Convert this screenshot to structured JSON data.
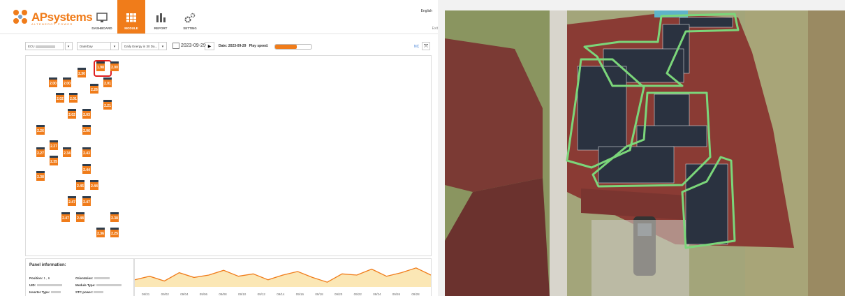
{
  "brand": {
    "name": "APsystems",
    "tagline": "ALTENERGY POWER"
  },
  "nav": [
    {
      "label": "DASHBOARD",
      "icon": "monitor-icon",
      "active": false
    },
    {
      "label": "MODULE",
      "icon": "grid-icon",
      "active": true
    },
    {
      "label": "REPORT",
      "icon": "bar-chart-icon",
      "active": false
    },
    {
      "label": "SETTING",
      "icon": "gear-icon",
      "active": false
    }
  ],
  "header": {
    "language": "English",
    "logout": "Exit"
  },
  "toolbar": {
    "ecu_select": "ECU ",
    "mode_select": "Date/Day",
    "energy_select": "Daily Energy in 30 Da...",
    "date": "2023-09-29",
    "date_label": "Date: 2023-09-29",
    "play_speed_label": "Play speed:",
    "play_speed_value": 0.6,
    "nc_label": "NC"
  },
  "panels": [
    {
      "v": "2.30",
      "c": "p1"
    },
    {
      "v": "1.98",
      "c": "p2"
    },
    {
      "v": "2.00",
      "c": "p3"
    },
    {
      "v": "2.00",
      "c": "p4"
    },
    {
      "v": "2.00",
      "c": "p5"
    },
    {
      "v": "2.01",
      "c": "p6"
    },
    {
      "v": "2.26",
      "c": "p7"
    },
    {
      "v": "2.02",
      "c": "p8"
    },
    {
      "v": "2.01",
      "c": "p9"
    },
    {
      "v": "2.21",
      "c": "p10"
    },
    {
      "v": "2.02",
      "c": "p11"
    },
    {
      "v": "2.03",
      "c": "p12"
    },
    {
      "v": "2.26",
      "c": "p13"
    },
    {
      "v": "2.06",
      "c": "p14"
    },
    {
      "v": "2.27",
      "c": "p15"
    },
    {
      "v": "2.27",
      "c": "p16"
    },
    {
      "v": "2.34",
      "c": "p17"
    },
    {
      "v": "2.43",
      "c": "p18"
    },
    {
      "v": "2.35",
      "c": "p19"
    },
    {
      "v": "2.44",
      "c": "p20"
    },
    {
      "v": "2.38",
      "c": "p21"
    },
    {
      "v": "2.45",
      "c": "p22"
    },
    {
      "v": "2.44",
      "c": "p23"
    },
    {
      "v": "2.47",
      "c": "p24"
    },
    {
      "v": "2.47",
      "c": "p25"
    },
    {
      "v": "2.47",
      "c": "p26"
    },
    {
      "v": "2.48",
      "c": "p27"
    },
    {
      "v": "2.38",
      "c": "p28"
    },
    {
      "v": "2.36",
      "c": "p29"
    },
    {
      "v": "2.25",
      "c": "p30"
    }
  ],
  "info": {
    "title": "Panel information:",
    "position_label": "Position:",
    "position_value": "1 , 6",
    "uid_label": "UID:",
    "uid_value": "",
    "inverter_label": "Inverter Type:",
    "inverter_value": "",
    "orientation_label": "Orientation:",
    "orientation_value": "",
    "module_label": "Module Type:",
    "module_value": "",
    "stc_label": "STC power:",
    "stc_value": ""
  },
  "graph": {
    "dates": [
      "08/31",
      "09/02",
      "09/04",
      "09/06",
      "09/08",
      "09/10",
      "09/12",
      "09/14",
      "09/16",
      "09/18",
      "09/20",
      "09/22",
      "09/24",
      "09/26",
      "09/28"
    ],
    "series": [
      0.3,
      0.45,
      0.25,
      0.6,
      0.4,
      0.5,
      0.7,
      0.45,
      0.55,
      0.3,
      0.5,
      0.65,
      0.4,
      0.2,
      0.55,
      0.5,
      0.75,
      0.45,
      0.6,
      0.8,
      0.5
    ],
    "color": "#f07c1a"
  },
  "colors": {
    "accent": "#f07c1a",
    "highlight": "#7bd67a",
    "roof": "#8a3b34"
  }
}
